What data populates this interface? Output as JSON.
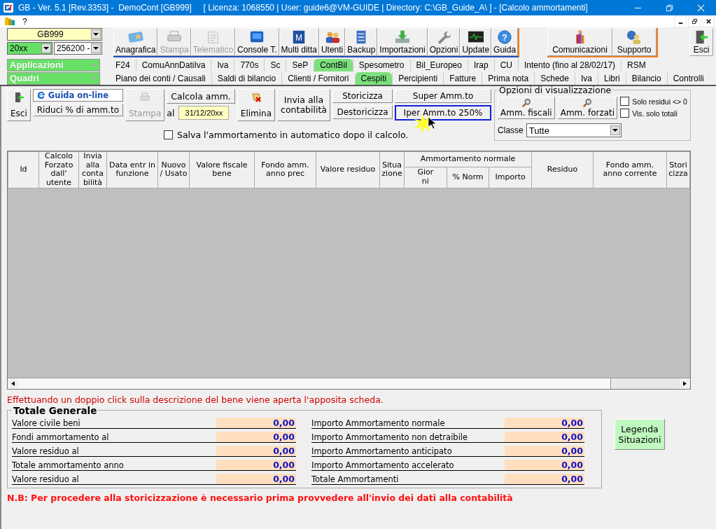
{
  "window": {
    "title": "GB - Ver. 5.1 [Rev.3353] -  DemoCont [GB999]     [ Licenza: 1068550 | User: guide6@VM-GUIDE | Directory: C:\\GB_Guide_A\\ ] - [Calcolo ammortamenti]"
  },
  "menu": [
    "?"
  ],
  "selectors": {
    "company": "GB999",
    "year": "20xx",
    "code": "256200 -",
    "applications": "Applicazioni",
    "panels": "Quadri"
  },
  "toolbar_main": [
    {
      "label": "Anagrafica",
      "kind": "card",
      "disabled": false
    },
    {
      "label": "Stampa",
      "kind": "printer",
      "disabled": true
    },
    {
      "label": "Telematico",
      "kind": "paper",
      "disabled": true
    },
    {
      "label": "Console T.",
      "kind": "console",
      "disabled": false
    },
    {
      "label": "Multi ditta",
      "kind": "letter",
      "glyph": "M",
      "disabled": false
    },
    {
      "label": "Utenti",
      "kind": "users",
      "disabled": false
    },
    {
      "label": "Backup",
      "kind": "cabinet",
      "disabled": false
    },
    {
      "label": "Importazioni",
      "kind": "import",
      "disabled": false
    },
    {
      "label": "Opzioni",
      "kind": "wrench",
      "disabled": false
    },
    {
      "label": "Update",
      "kind": "monitor",
      "disabled": false
    },
    {
      "label": "Guida",
      "kind": "help",
      "glyph": "?",
      "disabled": false
    }
  ],
  "toolbar_support": [
    {
      "label": "Comunicazioni",
      "kind": "people",
      "disabled": false
    },
    {
      "label": "Supporto",
      "kind": "support",
      "disabled": false
    }
  ],
  "exit_button": {
    "label": "Esci"
  },
  "tabs_row_1": [
    {
      "label": "F24",
      "selected": false
    },
    {
      "label": "ComuAnnDatiIva",
      "selected": false
    },
    {
      "label": "Iva",
      "selected": false
    },
    {
      "label": "770s",
      "selected": false
    },
    {
      "label": "Sc",
      "selected": false
    },
    {
      "label": "SeP",
      "selected": false
    },
    {
      "label": "ContBil",
      "selected": true
    },
    {
      "label": "Spesometro",
      "selected": false
    },
    {
      "label": "Bil_Europeo",
      "selected": false
    },
    {
      "label": "Irap",
      "selected": false
    },
    {
      "label": "CU",
      "selected": false
    },
    {
      "label": "Intento (fino al 28/02/17)",
      "selected": false
    },
    {
      "label": "RSM",
      "selected": false
    }
  ],
  "tabs_row_2": [
    {
      "label": "Piano dei conti / Causali",
      "selected": false
    },
    {
      "label": "Saldi di bilancio",
      "selected": false
    },
    {
      "label": "Clienti / Fornitori",
      "selected": false
    },
    {
      "label": "Cespiti",
      "selected": true
    },
    {
      "label": "Percipienti",
      "selected": false
    },
    {
      "label": "Fatture",
      "selected": false
    },
    {
      "label": "Prima nota",
      "selected": false
    },
    {
      "label": "Schede",
      "selected": false
    },
    {
      "label": "Iva",
      "selected": false
    },
    {
      "label": "Libri",
      "selected": false
    },
    {
      "label": "Bilancio",
      "selected": false
    },
    {
      "label": "Controlli",
      "selected": false
    }
  ],
  "actions": {
    "exit": "Esci",
    "online_help": "Guida on-line",
    "reduce": "Riduci % di amm.to",
    "print": {
      "label": "Stampa",
      "disabled": true
    },
    "calculate": "Calcola amm.",
    "date_label": "al",
    "date": "31/12/20xx",
    "delete": "Elimina",
    "send": "Invia alla contabilità",
    "historicize": "Storicizza",
    "unhistoricize": "Destoricizza",
    "super": "Super Amm.to",
    "iper": {
      "label": "Iper Amm.to 250%",
      "focused": true
    },
    "autosave": {
      "label": "Salva l'ammortamento in automatico dopo il calcolo.",
      "checked": false
    }
  },
  "view_options": {
    "title": "Opzioni di visualizzazione",
    "buttons": [
      "Amm. fiscali",
      "Amm. forzati"
    ],
    "checks": [
      {
        "label": "Solo residui <> 0",
        "checked": false
      },
      {
        "label": "Vis. solo totali",
        "checked": false
      }
    ],
    "class_label": "Classe",
    "class_value": "Tutte"
  },
  "table": {
    "columns": [
      "Id",
      "Calcolo\nForzato\ndall'\nutente",
      "Invia\nalla\nconta\nbilità",
      "Data entr in\nfunzione",
      "Nuovo\n/ Usato",
      "Valore fiscale\nbene",
      "Fondo amm.\nanno prec",
      "Valore residuo",
      "Situa\nzione"
    ],
    "group": {
      "label": "Ammortamento normale",
      "columns": [
        "Gior\nni",
        "% Norm",
        "Importo"
      ]
    },
    "columns_after": [
      "Residuo",
      "Fondo amm.\nanno corrente",
      "Stori\ncizza"
    ]
  },
  "hint": "Effettuando un doppio click sulla descrizione del bene viene aperta l'apposita scheda.",
  "totals": {
    "title": "Totale Generale",
    "left": [
      {
        "label": "Valore civile beni",
        "value": "0,00"
      },
      {
        "label": "Fondi ammortamento al",
        "value": "0,00"
      },
      {
        "label": "Valore residuo al",
        "value": "0,00"
      },
      {
        "label": "Totale ammortamento anno",
        "value": "0,00"
      },
      {
        "label": "Valore residuo al",
        "value": "0,00"
      }
    ],
    "right": [
      {
        "label": "Importo Ammortamento normale",
        "value": "0,00"
      },
      {
        "label": "Importo Ammortamento non detraibile",
        "value": "0,00"
      },
      {
        "label": "Importo Ammortamento anticipato",
        "value": "0,00"
      },
      {
        "label": "Importo Ammortamento accelerato",
        "value": "0,00"
      },
      {
        "label": "Totale Ammortamenti",
        "value": "0,00"
      }
    ]
  },
  "legend_button": "Legenda\nSituazioni",
  "note": "N.B: Per procedere alla storicizzazione è necessario prima provvedere all'invio dei dati alla contabilità"
}
